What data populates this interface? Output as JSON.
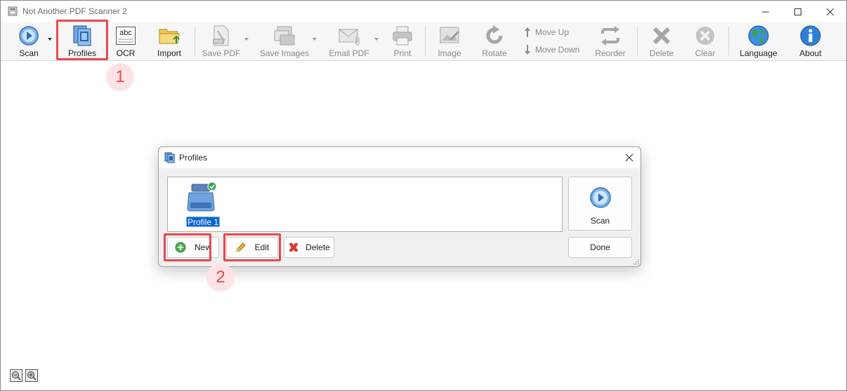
{
  "app": {
    "title": "Not Another PDF Scanner 2"
  },
  "window_controls": {
    "minimize_icon": "minimize-icon",
    "maximize_icon": "maximize-icon",
    "close_icon": "close-icon"
  },
  "toolbar": {
    "scan": "Scan",
    "profiles": "Profiles",
    "ocr": "OCR",
    "ocr_icon_text": "abc",
    "import": "Import",
    "save_pdf": "Save PDF",
    "save_pdf_icon_text": "PDF",
    "save_images": "Save Images",
    "email_pdf": "Email PDF",
    "print": "Print",
    "image": "Image",
    "rotate": "Rotate",
    "move_up": "Move Up",
    "move_down": "Move Down",
    "reorder": "Reorder",
    "delete": "Delete",
    "clear": "Clear",
    "language": "Language",
    "about": "About"
  },
  "annotations": {
    "step1": "1",
    "step2": "2",
    "highlight_color": "#e6494f"
  },
  "dialog": {
    "title": "Profiles",
    "profiles": [
      {
        "label": "Profile 1"
      }
    ],
    "buttons": {
      "new": "New",
      "edit": "Edit",
      "delete": "Delete",
      "scan": "Scan",
      "done": "Done"
    }
  },
  "colors": {
    "accent": "#0a64d6",
    "scan_blue": "#3a8ee6"
  }
}
